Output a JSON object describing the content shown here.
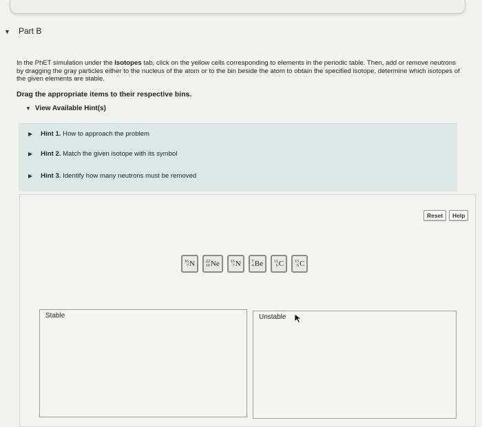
{
  "part": {
    "title": "Part B"
  },
  "instructions": {
    "p1": "In the PhET simulation under the ",
    "p1_bold": "Isotopes",
    "p2": " tab, click on the yellow cells corresponding to elements in the periodic table. Then, add or remove neutrons by dragging the gray particles either to the nucleus of the atom or to the bin beside the atom to obtain the specified isotope, determine which isotopes of the given elements are stable.",
    "task": "Drag the appropriate items to their respective bins."
  },
  "hints": {
    "toggle_label": "View Available Hint(s)",
    "items": [
      {
        "prefix": "Hint 1.",
        "text": " How to approach the problem"
      },
      {
        "prefix": "Hint 2.",
        "text": " Match the given isotope with its symbol"
      },
      {
        "prefix": "Hint 3.",
        "text": " Identify how many neutrons must be removed"
      }
    ]
  },
  "toolbar": {
    "reset_label": "Reset",
    "help_label": "Help"
  },
  "tiles": [
    {
      "mass": "16",
      "atomic": "7",
      "symbol": "N"
    },
    {
      "mass": "22",
      "atomic": "10",
      "symbol": "Ne"
    },
    {
      "mass": "15",
      "atomic": "7",
      "symbol": "N"
    },
    {
      "mass": "7",
      "atomic": "4",
      "symbol": "Be"
    },
    {
      "mass": "11",
      "atomic": "6",
      "symbol": "C"
    },
    {
      "mass": "13",
      "atomic": "6",
      "symbol": "C"
    }
  ],
  "bins": {
    "stable_label": "Stable",
    "unstable_label": "Unstable"
  }
}
